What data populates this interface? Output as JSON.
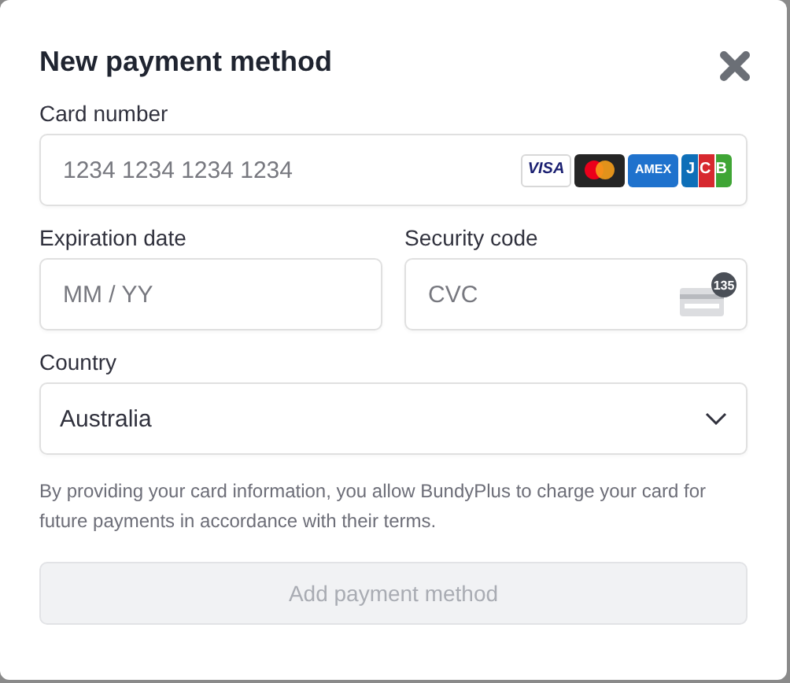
{
  "dialog": {
    "title": "New payment method"
  },
  "card_number": {
    "label": "Card number",
    "placeholder": "1234 1234 1234 1234",
    "brands": [
      {
        "kind": "visa",
        "label": "VISA"
      },
      {
        "kind": "mastercard"
      },
      {
        "kind": "amex",
        "label": "AMEX"
      },
      {
        "kind": "jcb",
        "label": "JCB"
      }
    ]
  },
  "expiration": {
    "label": "Expiration date",
    "placeholder": "MM / YY"
  },
  "security_code": {
    "label": "Security code",
    "placeholder": "CVC",
    "badge": "135"
  },
  "country": {
    "label": "Country",
    "value": "Australia"
  },
  "notice": "By providing your card information, you allow BundyPlus to charge your card for future payments in accordance with their terms.",
  "submit": {
    "label": "Add payment method",
    "disabled": true
  }
}
